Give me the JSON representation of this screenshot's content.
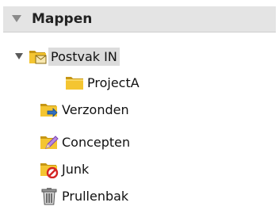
{
  "header": {
    "title": "Mappen"
  },
  "folders": [
    {
      "label": "Postvak IN",
      "icon": "inbox-folder-icon",
      "expanded": true,
      "selected": true
    },
    {
      "label": "ProjectA",
      "icon": "folder-icon"
    },
    {
      "label": "Verzonden",
      "icon": "sent-folder-icon"
    },
    {
      "label": "Concepten",
      "icon": "drafts-folder-icon"
    },
    {
      "label": "Junk",
      "icon": "junk-folder-icon"
    },
    {
      "label": "Prullenbak",
      "icon": "trash-icon"
    }
  ],
  "colors": {
    "header_bg": "#e4e4e4",
    "selected_bg": "#dcdcdc",
    "folder_yellow": "#f4c531",
    "folder_dark": "#c69614",
    "sent_blue": "#2f6fc0",
    "drafts_pen": "#7a3fb5",
    "junk_red": "#d42424"
  }
}
